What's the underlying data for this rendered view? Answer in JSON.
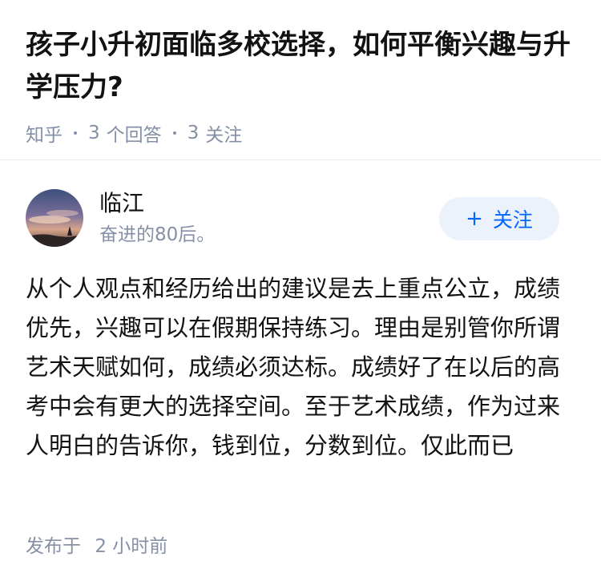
{
  "question": {
    "title": "孩子小升初面临多校选择，如何平衡兴趣与升学压力?",
    "source": "知乎",
    "answer_count": "3",
    "answer_label": "个回答",
    "follower_count": "3",
    "follower_label": "关注"
  },
  "author": {
    "avatar_icon": "avatar-sunset-sky",
    "name": "临江",
    "bio": "奋进的80后。",
    "follow_label": "关注",
    "follow_icon": "plus-icon"
  },
  "answer": {
    "content": "从个人观点和经历给出的建议是去上重点公立，成绩优先，兴趣可以在假期保持练习。理由是别管你所谓艺术天赋如何，成绩必须达标。成绩好了在以后的高考中会有更大的选择空间。至于艺术成绩，作为过来人明白的告诉你，钱到位，分数到位。仅此而已",
    "published_prefix": "发布于",
    "published_time": "2 小时前"
  },
  "colors": {
    "title": "#121212",
    "meta": "#8590a6",
    "accent": "#0066ff",
    "follow_bg": "#ebf2fb"
  }
}
